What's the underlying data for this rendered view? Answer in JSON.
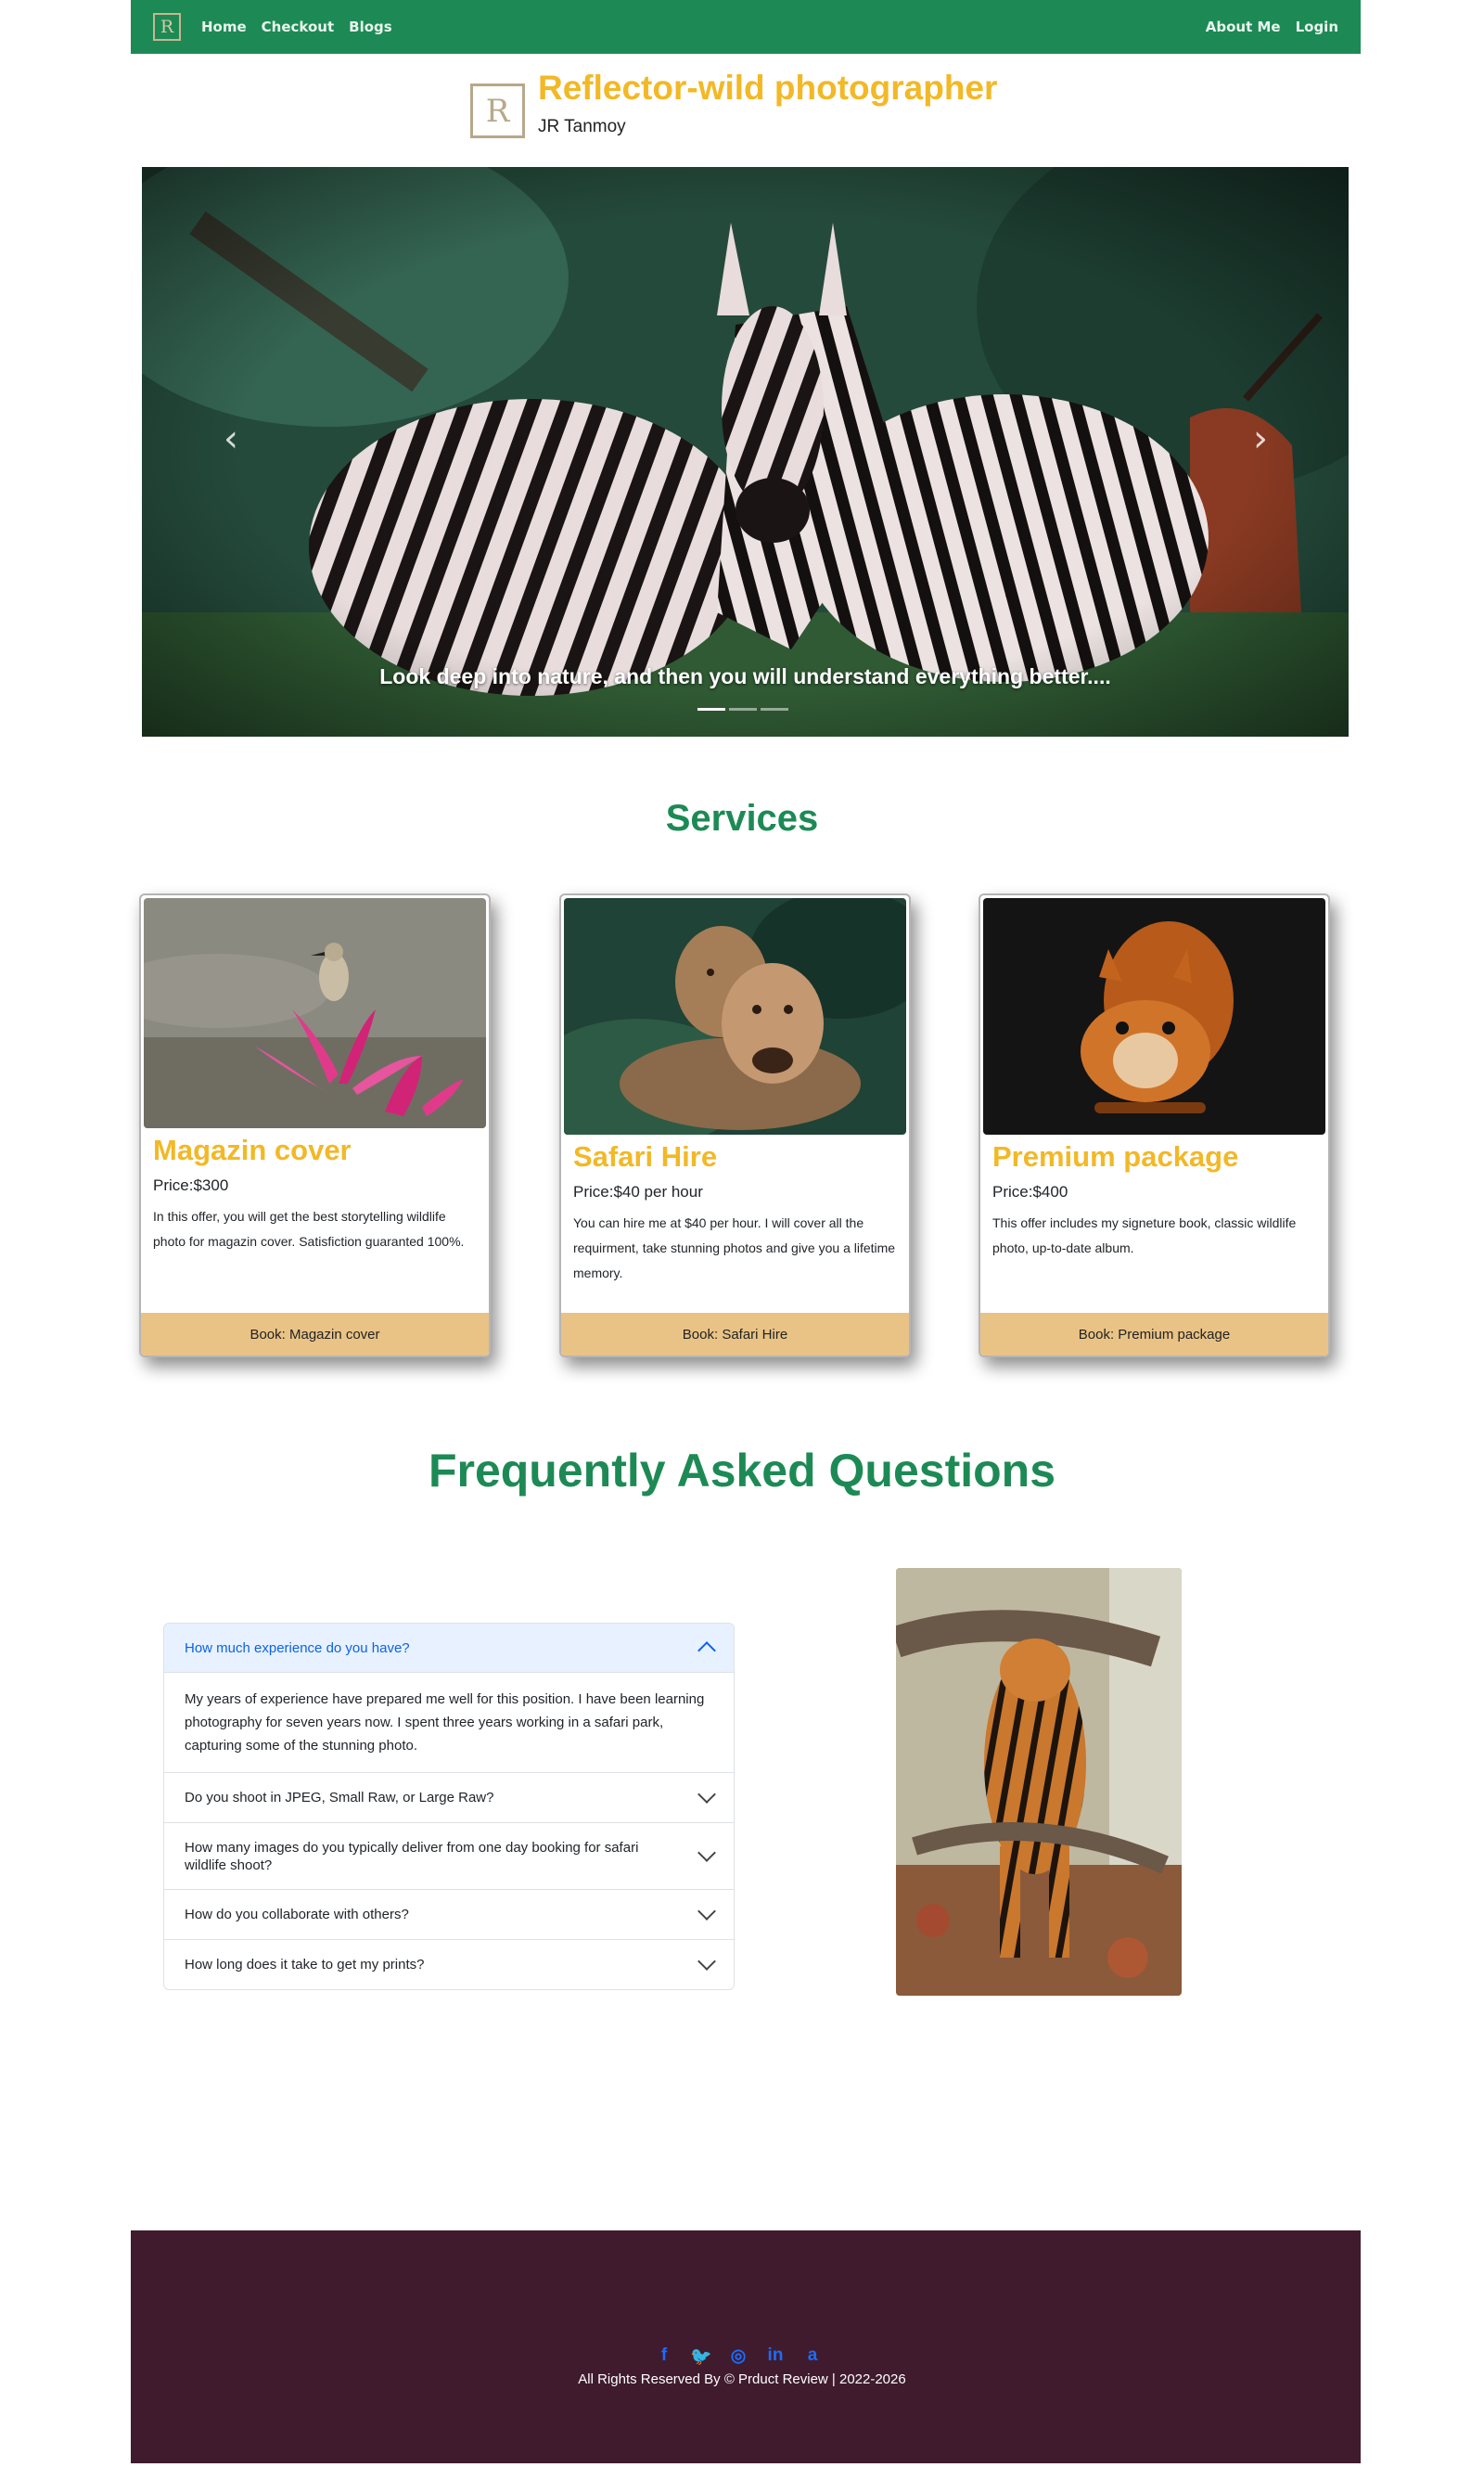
{
  "nav": {
    "logo_letter": "R",
    "links": [
      "Home",
      "Checkout",
      "Blogs"
    ],
    "right_links": [
      "About Me",
      "Login"
    ]
  },
  "brand": {
    "logo_letter": "R",
    "title": "Reflector-wild photographer",
    "subtitle": "JR Tanmoy"
  },
  "carousel": {
    "caption": "Look deep into nature, and then you will understand everything better....",
    "prev_icon": "chevron-left-icon",
    "next_icon": "chevron-right-icon",
    "slide_count": 3,
    "active_slide": 1
  },
  "services": {
    "title": "Services",
    "cards": [
      {
        "title": "Magazin cover",
        "price": "Price:$300",
        "text": "In this offer, you will get the best storytelling wildlife photo for magazin cover. Satisfiction guaranted 100%.",
        "button": "Book: Magazin cover"
      },
      {
        "title": "Safari Hire",
        "price": "Price:$40 per hour",
        "text": "You can hire me at $40 per hour. I will cover all the requirment, take stunning photos and give you a lifetime memory.",
        "button": "Book: Safari Hire"
      },
      {
        "title": "Premium package",
        "price": "Price:$400",
        "text": "This offer includes my signeture book, classic wildlife photo, up-to-date album.",
        "button": "Book: Premium package"
      }
    ]
  },
  "faq": {
    "title": "Frequently Asked Questions",
    "items": [
      {
        "question": "How much experience do you have?",
        "answer": "My years of experience have prepared me well for this position. I have been learning photography for seven years now. I spent three years working in a safari park, capturing some of the stunning photo.",
        "open": true
      },
      {
        "question": "Do you shoot in JPEG, Small Raw, or Large Raw?",
        "open": false
      },
      {
        "question": "How many images do you typically deliver from one day booking for safari wildlife shoot?",
        "open": false
      },
      {
        "question": "How do you collaborate with others?",
        "open": false
      },
      {
        "question": "How long does it take to get my prints?",
        "open": false
      }
    ]
  },
  "footer": {
    "social_icons": [
      "facebook-icon",
      "twitter-icon",
      "github-icon",
      "linkedin-icon",
      "amazon-icon"
    ],
    "copyright": "All Rights Reserved By © Prduct Review | 2022-2026"
  },
  "colors": {
    "nav_bg": "#1d8a55",
    "accent_yellow": "#f2b826",
    "heading_green": "#1d8a55",
    "button_tan": "#e9c386",
    "footer_bg": "#3f1b2d",
    "social_blue": "#1a6cff"
  }
}
